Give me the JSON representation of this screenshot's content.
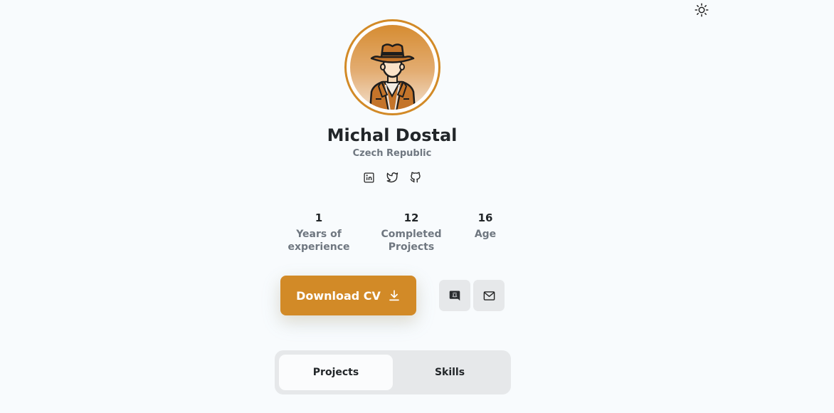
{
  "header": {
    "theme_toggle_icon": "sun-icon"
  },
  "profile": {
    "avatar_icon": "cowboy-avatar",
    "name": "Michal Dostal",
    "country": "Czech Republic",
    "socials": [
      {
        "icon": "linkedin-icon"
      },
      {
        "icon": "twitter-icon"
      },
      {
        "icon": "github-icon"
      }
    ]
  },
  "stats": [
    {
      "value": "1",
      "label": "Years of\nexperience"
    },
    {
      "value": "12",
      "label": "Completed\nProjects"
    },
    {
      "value": "16",
      "label": "Age"
    }
  ],
  "actions": {
    "download_cv_label": "Download CV",
    "download_icon": "download-icon",
    "discord_icon": "discord-icon",
    "mail_icon": "mail-icon"
  },
  "tabs": [
    {
      "label": "Projects",
      "active": true
    },
    {
      "label": "Skills",
      "active": false
    }
  ],
  "colors": {
    "accent": "#d28a27",
    "background": "#f8fbfd",
    "muted": "#6f7780"
  }
}
